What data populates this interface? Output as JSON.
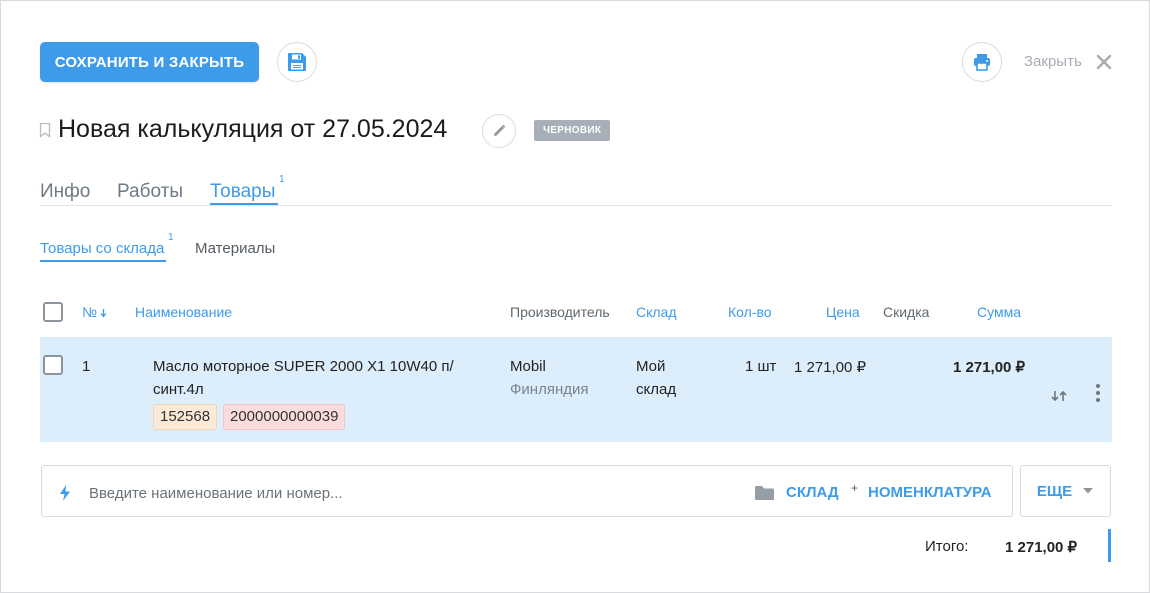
{
  "toolbar": {
    "save_close_label": "СОХРАНИТЬ И ЗАКРЫТЬ",
    "close_label": "Закрыть"
  },
  "header": {
    "title": "Новая калькуляция от 27.05.2024",
    "status": "ЧЕРНОВИК"
  },
  "tabs": [
    {
      "label": "Инфо",
      "count": ""
    },
    {
      "label": "Работы",
      "count": ""
    },
    {
      "label": "Товары",
      "count": "1"
    }
  ],
  "subtabs": [
    {
      "label": "Товары со склада",
      "count": "1"
    },
    {
      "label": "Материалы",
      "count": ""
    }
  ],
  "table": {
    "columns": {
      "num": "№",
      "name": "Наименование",
      "manufacturer": "Производитель",
      "warehouse": "Склад",
      "qty": "Кол-во",
      "price": "Цена",
      "discount": "Скидка",
      "sum": "Сумма"
    },
    "rows": [
      {
        "num": "1",
        "name_line1": "Масло моторное SUPER 2000 X1 10W40 п/",
        "name_line2": "синт.4л",
        "code": "152568",
        "barcode": "2000000000039",
        "manufacturer": "Mobil",
        "country": "Финляндия",
        "warehouse_line1": "Мой",
        "warehouse_line2": "склад",
        "qty": "1 шт",
        "price": "1 271,00 ₽",
        "discount": "",
        "sum": "1 271,00 ₽"
      }
    ]
  },
  "search": {
    "placeholder": "Введите наименование или номер...",
    "value": "",
    "warehouse_label": "СКЛАД",
    "plus": "+",
    "nomenclature_label": "НОМЕНКЛАТУРА",
    "more_label": "ЕЩЕ"
  },
  "totals": {
    "label": "Итого:",
    "value": "1 271,00 ₽"
  },
  "colors": {
    "accent": "#3d9be9",
    "row_highlight": "#dcedfb",
    "badge_grey": "#a7afb9"
  },
  "icons": {
    "save": "floppy-disk-icon",
    "print": "printer-icon",
    "close": "close-icon",
    "edit": "pencil-icon",
    "bookmark": "bookmark-icon",
    "search": "lightning-icon",
    "folder": "folder-icon"
  }
}
